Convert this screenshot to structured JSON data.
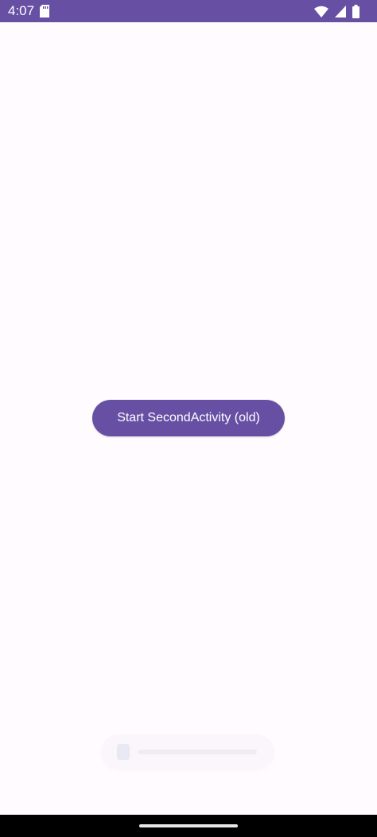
{
  "status_bar": {
    "time": "4:07",
    "background_color": "#6750a4",
    "icons": [
      "sd-card-icon",
      "wifi-icon",
      "cell-signal-icon",
      "battery-icon"
    ]
  },
  "main": {
    "button_label": "Start SecondActivity (old)",
    "button_color": "#6750a4",
    "background_color": "#fffbfe"
  },
  "navigation_bar": {
    "background_color": "#000000"
  }
}
